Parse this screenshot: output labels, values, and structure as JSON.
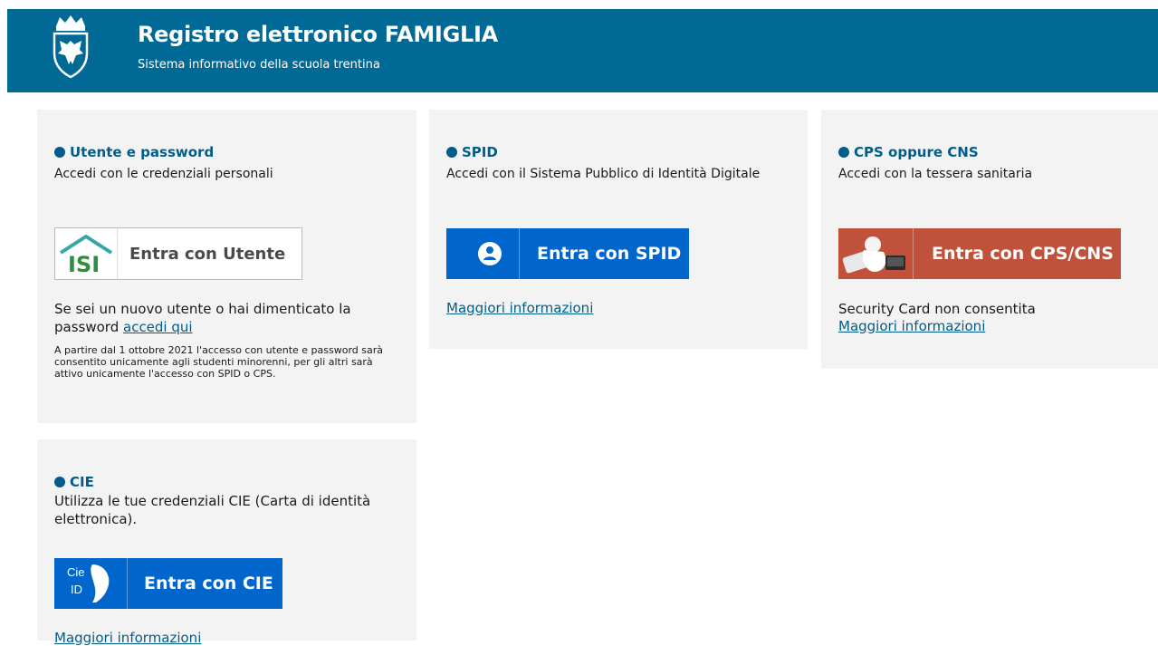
{
  "header": {
    "title": "Registro elettronico FAMIGLIA",
    "subtitle": "Sistema informativo della scuola trentina",
    "colors": {
      "bar": "#006995"
    }
  },
  "utente": {
    "heading": "Utente e password",
    "description": "Accedi con le credenziali personali",
    "button_logo": "ISI",
    "button_label": "Entra con Utente",
    "new_user_text": "Se sei un nuovo utente o hai dimenticato la password",
    "new_user_link": "accedi qui",
    "notice": "A partire dal 1 ottobre 2021 l'accesso con utente e password sarà consentito unicamente agli studenti minorenni, per gli altri sarà attivo unicamente l'accesso con SPID o CPS."
  },
  "spid": {
    "heading": "SPID",
    "description": "Accedi con il Sistema Pubblico di Identità Digitale",
    "button_label": "Entra con SPID",
    "info_link": "Maggiori informazioni",
    "colors": {
      "button": "#0066cc"
    }
  },
  "cps": {
    "heading": "CPS oppure CNS",
    "description": "Accedi con la tessera sanitaria",
    "button_label": "Entra con CPS/CNS",
    "note": "Security Card non consentita",
    "info_link": "Maggiori informazioni",
    "colors": {
      "button": "#c0513a"
    }
  },
  "cie": {
    "heading": "CIE",
    "description": "Utilizza le tue credenziali CIE (Carta di identità elettronica).",
    "button_logo_top": "Cie",
    "button_logo_bottom": "ID",
    "button_label": "Entra con CIE",
    "info_link": "Maggiori informazioni",
    "colors": {
      "button": "#0066cc"
    }
  },
  "colors": {
    "accent": "#005d8a",
    "card": "#f3f3f3"
  }
}
